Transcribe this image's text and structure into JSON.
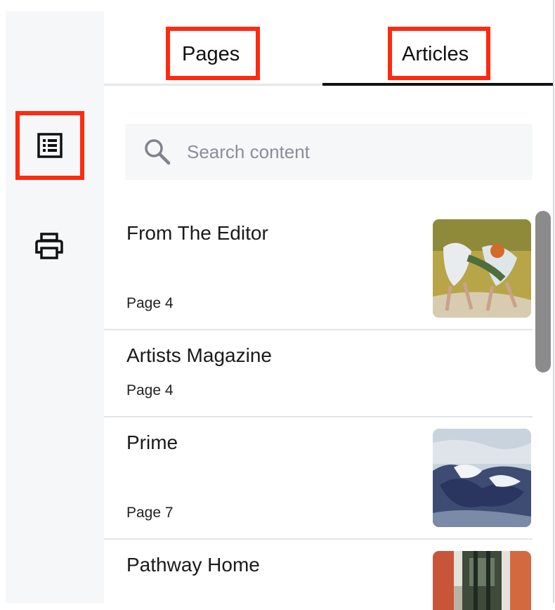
{
  "tabs": [
    {
      "label": "Pages"
    },
    {
      "label": "Articles"
    }
  ],
  "rail": {
    "items": [
      {
        "icon": "table-of-contents-icon"
      },
      {
        "icon": "printer-icon"
      }
    ]
  },
  "search": {
    "placeholder": "Search content",
    "value": ""
  },
  "articles": [
    {
      "title": "From The Editor",
      "page": "Page 4",
      "thumbnail": "dancers-painting"
    },
    {
      "title": "Artists Magazine",
      "page": "Page 4"
    },
    {
      "title": "Prime",
      "page": "Page 7",
      "thumbnail": "seascape-painting"
    },
    {
      "title": "Pathway Home",
      "thumbnail": "street-painting"
    }
  ],
  "colors": {
    "highlight": "#ff2a10",
    "active_tab_underline": "#111111",
    "rail_background": "#f6f7f9",
    "scrollbar": "#8b8b8b"
  }
}
